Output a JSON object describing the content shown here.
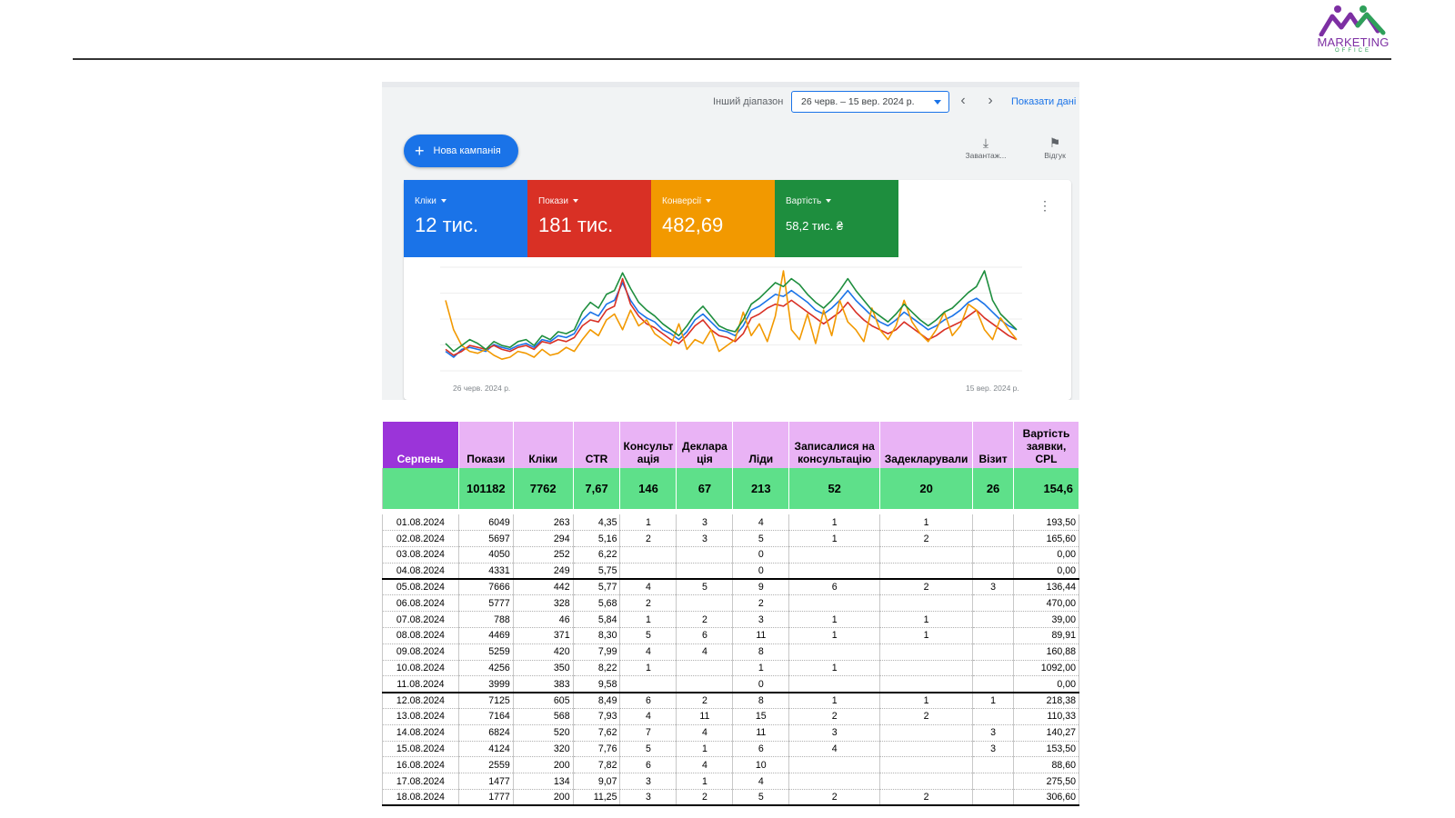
{
  "logo": {
    "text": "MARKETING",
    "sub": "OFFICE"
  },
  "ads": {
    "range_label": "Інший діапазон",
    "range_value": "26 черв. – 15 вер. 2024 р.",
    "show_data": "Показати дані :",
    "new_campaign": "Нова кампанія",
    "tool_download": "Завантаж...",
    "tool_feedback": "Відгук",
    "metrics": [
      {
        "label": "Кліки",
        "value": "12 тис."
      },
      {
        "label": "Покази",
        "value": "181 тис."
      },
      {
        "label": "Конверсії",
        "value": "482,69"
      },
      {
        "label": "Вартість",
        "value": "58,2 тис. ₴"
      }
    ],
    "colors": {
      "blue": "#1a73e8",
      "red": "#d93025",
      "yellow": "#f29900",
      "green": "#1e8e3e"
    },
    "date_start": "26 черв. 2024 р.",
    "date_end": "15 вер. 2024 р."
  },
  "chart_data": {
    "type": "line",
    "series": [
      {
        "color": "#1a73e8",
        "values": [
          18,
          12,
          20,
          22,
          20,
          18,
          25,
          22,
          20,
          24,
          26,
          22,
          30,
          28,
          34,
          32,
          36,
          50,
          58,
          54,
          66,
          70,
          88,
          70,
          58,
          52,
          48,
          40,
          36,
          30,
          38,
          50,
          56,
          48,
          40,
          38,
          34,
          44,
          60,
          64,
          70,
          76,
          74,
          80,
          74,
          68,
          60,
          56,
          62,
          70,
          80,
          70,
          62,
          54,
          48,
          44,
          50,
          58,
          52,
          46,
          40,
          44,
          50,
          54,
          60,
          68,
          72,
          66,
          58,
          50,
          44,
          40
        ]
      },
      {
        "color": "#d93025",
        "values": [
          20,
          14,
          18,
          24,
          22,
          20,
          24,
          20,
          18,
          22,
          24,
          20,
          28,
          26,
          30,
          28,
          32,
          44,
          50,
          48,
          60,
          64,
          92,
          66,
          54,
          46,
          42,
          36,
          30,
          26,
          34,
          44,
          50,
          40,
          34,
          32,
          28,
          36,
          52,
          56,
          62,
          66,
          64,
          70,
          64,
          58,
          52,
          46,
          52,
          58,
          68,
          58,
          50,
          44,
          40,
          36,
          40,
          48,
          42,
          36,
          30,
          34,
          40,
          44,
          48,
          54,
          60,
          52,
          46,
          40,
          34,
          30
        ]
      },
      {
        "color": "#f29900",
        "values": [
          70,
          40,
          24,
          18,
          16,
          20,
          14,
          10,
          12,
          18,
          16,
          12,
          20,
          14,
          16,
          22,
          18,
          30,
          40,
          34,
          50,
          56,
          40,
          60,
          44,
          50,
          36,
          30,
          24,
          46,
          20,
          30,
          26,
          40,
          18,
          24,
          30,
          58,
          34,
          46,
          28,
          54,
          100,
          40,
          30,
          56,
          26,
          60,
          34,
          70,
          48,
          40,
          28,
          62,
          40,
          30,
          44,
          70,
          48,
          36,
          28,
          40,
          58,
          34,
          44,
          66,
          60,
          40,
          30,
          52,
          40,
          30
        ]
      },
      {
        "color": "#1e8e3e",
        "values": [
          26,
          18,
          24,
          30,
          26,
          20,
          28,
          24,
          22,
          28,
          30,
          24,
          34,
          30,
          38,
          36,
          40,
          58,
          68,
          62,
          76,
          80,
          98,
          82,
          68,
          60,
          54,
          46,
          40,
          34,
          44,
          56,
          64,
          54,
          44,
          40,
          38,
          50,
          66,
          72,
          80,
          88,
          84,
          92,
          86,
          76,
          68,
          62,
          70,
          80,
          92,
          80,
          70,
          60,
          54,
          48,
          56,
          66,
          58,
          50,
          44,
          50,
          58,
          62,
          70,
          78,
          84,
          100,
          70,
          56,
          48,
          40
        ]
      }
    ]
  },
  "table": {
    "month": "Серпень",
    "headers": [
      "Покази",
      "Кліки",
      "CTR",
      "Консульт ація",
      "Деклара ція",
      "Ліди",
      "Записалися на консультацію",
      "Задекларували",
      "Візит",
      "Вартість заявки, CPL"
    ],
    "totals": [
      "101182",
      "7762",
      "7,67",
      "146",
      "67",
      "213",
      "52",
      "20",
      "26",
      "154,6"
    ],
    "rows": [
      [
        "01.08.2024",
        "6049",
        "263",
        "4,35",
        "1",
        "3",
        "4",
        "1",
        "1",
        "",
        "193,50"
      ],
      [
        "02.08.2024",
        "5697",
        "294",
        "5,16",
        "2",
        "3",
        "5",
        "1",
        "2",
        "",
        "165,60"
      ],
      [
        "03.08.2024",
        "4050",
        "252",
        "6,22",
        "",
        "",
        "0",
        "",
        "",
        "",
        "0,00"
      ],
      [
        "04.08.2024",
        "4331",
        "249",
        "5,75",
        "",
        "",
        "0",
        "",
        "",
        "",
        "0,00"
      ],
      [
        "05.08.2024",
        "7666",
        "442",
        "5,77",
        "4",
        "5",
        "9",
        "6",
        "2",
        "3",
        "136,44"
      ],
      [
        "06.08.2024",
        "5777",
        "328",
        "5,68",
        "2",
        "",
        "2",
        "",
        "",
        "",
        "470,00"
      ],
      [
        "07.08.2024",
        "788",
        "46",
        "5,84",
        "1",
        "2",
        "3",
        "1",
        "1",
        "",
        "39,00"
      ],
      [
        "08.08.2024",
        "4469",
        "371",
        "8,30",
        "5",
        "6",
        "11",
        "1",
        "1",
        "",
        "89,91"
      ],
      [
        "09.08.2024",
        "5259",
        "420",
        "7,99",
        "4",
        "4",
        "8",
        "",
        "",
        "",
        "160,88"
      ],
      [
        "10.08.2024",
        "4256",
        "350",
        "8,22",
        "1",
        "",
        "1",
        "1",
        "",
        "",
        "1092,00"
      ],
      [
        "11.08.2024",
        "3999",
        "383",
        "9,58",
        "",
        "",
        "0",
        "",
        "",
        "",
        "0,00"
      ],
      [
        "12.08.2024",
        "7125",
        "605",
        "8,49",
        "6",
        "2",
        "8",
        "1",
        "1",
        "1",
        "218,38"
      ],
      [
        "13.08.2024",
        "7164",
        "568",
        "7,93",
        "4",
        "11",
        "15",
        "2",
        "2",
        "",
        "110,33"
      ],
      [
        "14.08.2024",
        "6824",
        "520",
        "7,62",
        "7",
        "4",
        "11",
        "3",
        "",
        "3",
        "140,27"
      ],
      [
        "15.08.2024",
        "4124",
        "320",
        "7,76",
        "5",
        "1",
        "6",
        "4",
        "",
        "3",
        "153,50"
      ],
      [
        "16.08.2024",
        "2559",
        "200",
        "7,82",
        "6",
        "4",
        "10",
        "",
        "",
        "",
        "88,60"
      ],
      [
        "17.08.2024",
        "1477",
        "134",
        "9,07",
        "3",
        "1",
        "4",
        "",
        "",
        "",
        "275,50"
      ],
      [
        "18.08.2024",
        "1777",
        "200",
        "11,25",
        "3",
        "2",
        "5",
        "2",
        "2",
        "",
        "306,60"
      ]
    ]
  }
}
